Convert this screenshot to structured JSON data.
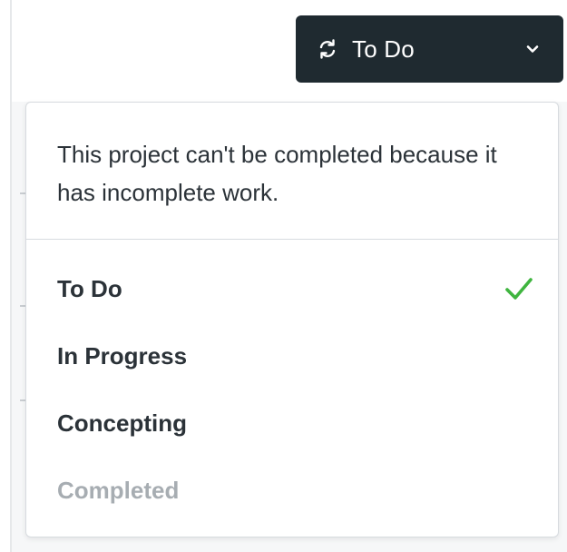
{
  "status_button": {
    "label": "To Do",
    "icon": "cycle-icon",
    "chevron": "chevron-down-icon",
    "background": "#1f2a30"
  },
  "popover": {
    "notice": "This project can't be completed because it has incomplete work.",
    "options": [
      {
        "label": "To Do",
        "selected": true,
        "disabled": false
      },
      {
        "label": "In Progress",
        "selected": false,
        "disabled": false
      },
      {
        "label": "Concepting",
        "selected": false,
        "disabled": false
      },
      {
        "label": "Completed",
        "selected": false,
        "disabled": true
      }
    ],
    "check_icon": "checkmark-icon",
    "check_color": "#3fb53f"
  }
}
